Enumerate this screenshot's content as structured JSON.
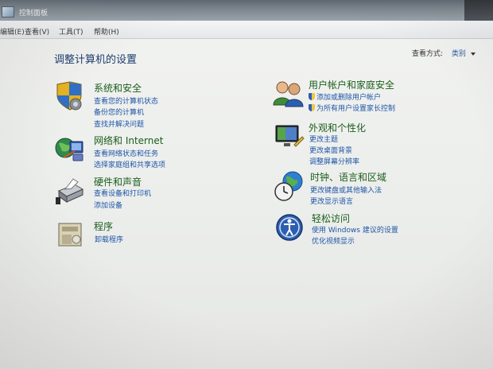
{
  "window": {
    "title": "控制面板"
  },
  "menu": {
    "edit": "编辑(E)",
    "view": "查看(V)",
    "tools": "工具(T)",
    "help": "帮助(H)"
  },
  "page": {
    "title": "调整计算机的设置",
    "view_by_label": "查看方式:",
    "view_by_value": "类别"
  },
  "categories": {
    "system": {
      "title": "系统和安全",
      "links": [
        "查看您的计算机状态",
        "备份您的计算机",
        "查找并解决问题"
      ],
      "icon": "shield-icon"
    },
    "network": {
      "title": "网络和 Internet",
      "links": [
        "查看网络状态和任务",
        "选择家庭组和共享选项"
      ],
      "icon": "globe-network-icon"
    },
    "hardware": {
      "title": "硬件和声音",
      "links": [
        "查看设备和打印机",
        "添加设备"
      ],
      "icon": "printer-icon"
    },
    "programs": {
      "title": "程序",
      "links": [
        "卸载程序"
      ],
      "icon": "programs-icon"
    },
    "users": {
      "title": "用户帐户和家庭安全",
      "links": [
        "添加或删除用户帐户",
        "为所有用户设置家长控制"
      ],
      "icon": "users-icon"
    },
    "appearance": {
      "title": "外观和个性化",
      "links": [
        "更改主题",
        "更改桌面背景",
        "调整屏幕分辨率"
      ],
      "icon": "monitor-icon"
    },
    "clock": {
      "title": "时钟、语言和区域",
      "links": [
        "更改键盘或其他输入法",
        "更改显示语言"
      ],
      "icon": "clock-globe-icon"
    },
    "ease": {
      "title": "轻松访问",
      "links": [
        "使用 Windows 建议的设置",
        "优化视频显示"
      ],
      "icon": "ease-of-access-icon"
    }
  },
  "colors": {
    "category_title": "#1b5e1b",
    "link": "#1f55a6",
    "page_title": "#1d3d6e"
  }
}
